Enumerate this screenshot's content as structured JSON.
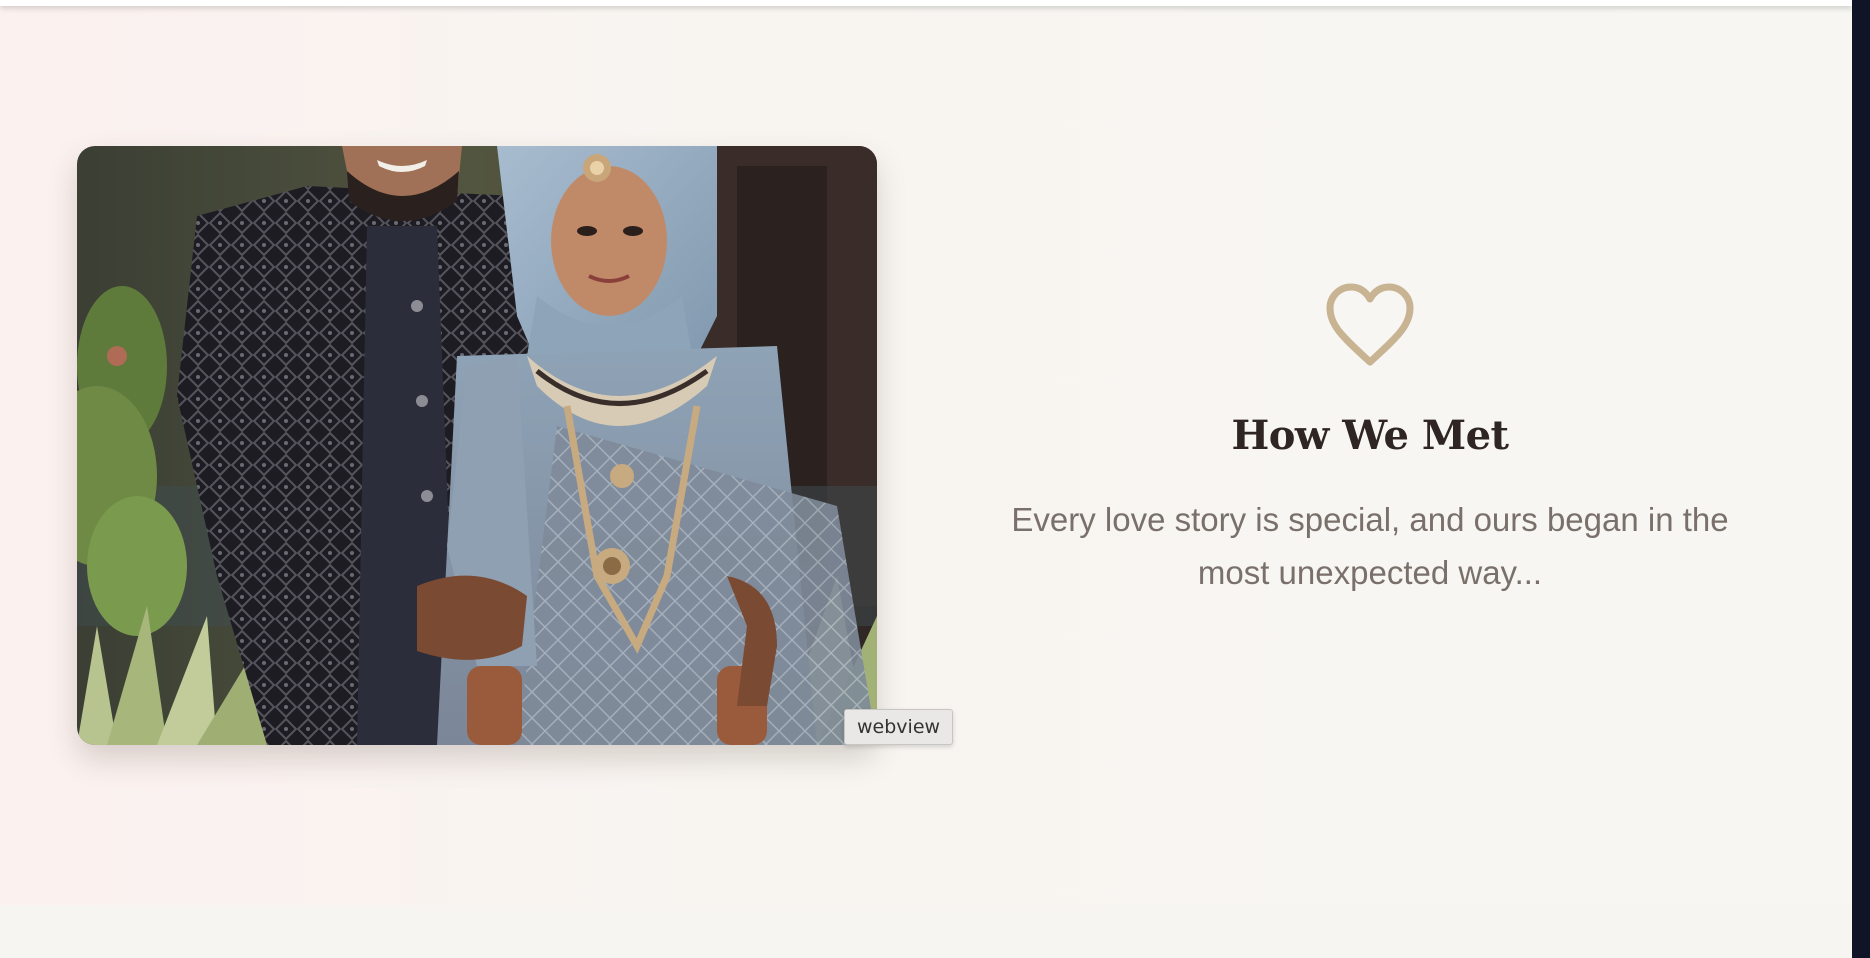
{
  "section": {
    "icon": "heart-icon",
    "title": "How We Met",
    "subtitle": "Every love story is special, and ours began in the most unexpected way..."
  },
  "photo": {
    "alt": "couple-photo"
  },
  "tooltip": {
    "label": "webview"
  },
  "colors": {
    "accent": "#c8b392",
    "heading": "#2f2522",
    "body_text": "#7a706b",
    "background": "#f7f6f2"
  }
}
